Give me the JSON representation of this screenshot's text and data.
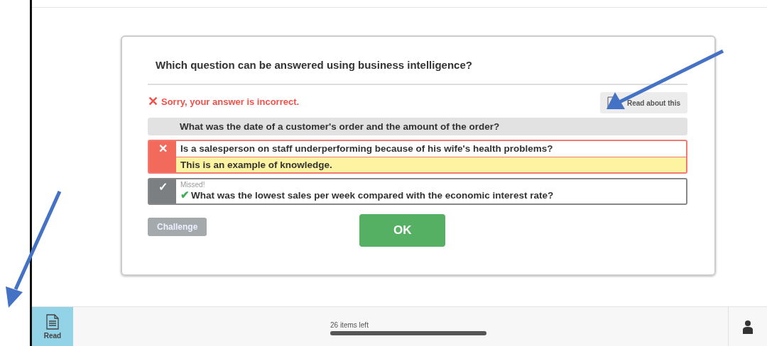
{
  "question": "Which question can be answered using business intelligence?",
  "feedback": {
    "icon": "✕",
    "text": "Sorry, your answer is incorrect."
  },
  "read_about": {
    "label": "Read about this"
  },
  "options": [
    {
      "kind": "plain",
      "text": "What was the date of a customer's order and the amount of the order?"
    },
    {
      "kind": "wrong",
      "mark": "✕",
      "text": "Is a salesperson on staff underperforming because of his wife's health problems?",
      "explanation": "This is an example of knowledge."
    },
    {
      "kind": "missed",
      "mark": "✓",
      "note": "Missed!",
      "check": "✔",
      "text": "What was the lowest sales per week compared with the economic interest rate?"
    }
  ],
  "buttons": {
    "challenge": {
      "label": "Challenge",
      "disabled": true
    },
    "ok": {
      "label": "OK"
    }
  },
  "bottom_bar": {
    "read": {
      "label": "Read",
      "selected": true
    },
    "progress": {
      "label": "26 items left",
      "level": 1
    }
  }
}
